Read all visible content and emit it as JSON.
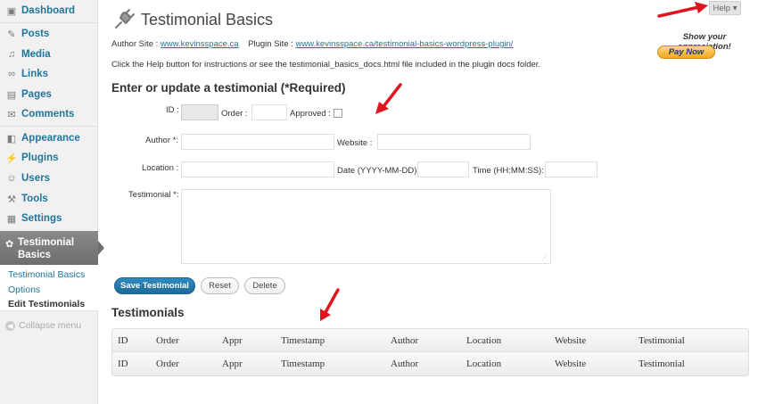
{
  "sidebar": {
    "items": [
      {
        "label": "Dashboard",
        "icon": "dashboard-icon",
        "glyph": "▣"
      },
      {
        "label": "Posts",
        "icon": "pushpin-icon",
        "glyph": "✎"
      },
      {
        "label": "Media",
        "icon": "media-icon",
        "glyph": "♫"
      },
      {
        "label": "Links",
        "icon": "link-icon",
        "glyph": "∞"
      },
      {
        "label": "Pages",
        "icon": "pages-icon",
        "glyph": "▤"
      },
      {
        "label": "Comments",
        "icon": "comments-icon",
        "glyph": "✉"
      },
      {
        "label": "Appearance",
        "icon": "appearance-icon",
        "glyph": "◧"
      },
      {
        "label": "Plugins",
        "icon": "plugins-icon",
        "glyph": "⚡"
      },
      {
        "label": "Users",
        "icon": "users-icon",
        "glyph": "☺"
      },
      {
        "label": "Tools",
        "icon": "tools-icon",
        "glyph": "⚒"
      },
      {
        "label": "Settings",
        "icon": "settings-icon",
        "glyph": "▦"
      }
    ],
    "active": {
      "label": "Testimonial Basics",
      "icon": "gear-icon",
      "glyph": "✿"
    },
    "submenu": [
      {
        "label": "Testimonial Basics"
      },
      {
        "label": "Options"
      },
      {
        "label": "Edit Testimonials"
      }
    ],
    "collapse_label": "Collapse menu"
  },
  "header": {
    "title": "Testimonial Basics",
    "help_label": "Help ▾",
    "appreciation": "Show your appreciation!",
    "paynow_label": "Pay Now"
  },
  "info": {
    "author_site_label": "Author Site :",
    "author_site_link": "www.kevinsspace.ca",
    "plugin_site_label": "Plugin Site :",
    "plugin_site_link": "www.kevinsspace.ca/testimonial-basics-wordpress-plugin/",
    "help_text": "Click the Help button for instructions or see the testimonial_basics_docs.html file included in the plugin docs folder."
  },
  "form": {
    "title": "Enter or update a testimonial (*Required)",
    "id_label": "ID :",
    "order_label": "Order :",
    "approved_label": "Approved :",
    "author_label": "Author *:",
    "website_label": "Website :",
    "location_label": "Location :",
    "date_label": "Date (YYYY-MM-DD):",
    "time_label": "Time (HH:MM:SS):",
    "testimonial_label": "Testimonial *:",
    "save_label": "Save Testimonial",
    "reset_label": "Reset",
    "delete_label": "Delete"
  },
  "testimonials": {
    "title": "Testimonials",
    "columns": [
      "ID",
      "Order",
      "Appr",
      "Timestamp",
      "Author",
      "Location",
      "Website",
      "Testimonial"
    ],
    "rows": [
      [
        "ID",
        "Order",
        "Appr",
        "Timestamp",
        "Author",
        "Location",
        "Website",
        "Testimonial"
      ],
      [
        "ID",
        "Order",
        "Appr",
        "Timestamp",
        "Author",
        "Location",
        "Website",
        "Testimonial"
      ]
    ]
  },
  "colors": {
    "link": "#21759b",
    "accent_button": "#2e8bc0",
    "annotation_arrow": "#e0141e",
    "paynow": "#f4a81b"
  }
}
